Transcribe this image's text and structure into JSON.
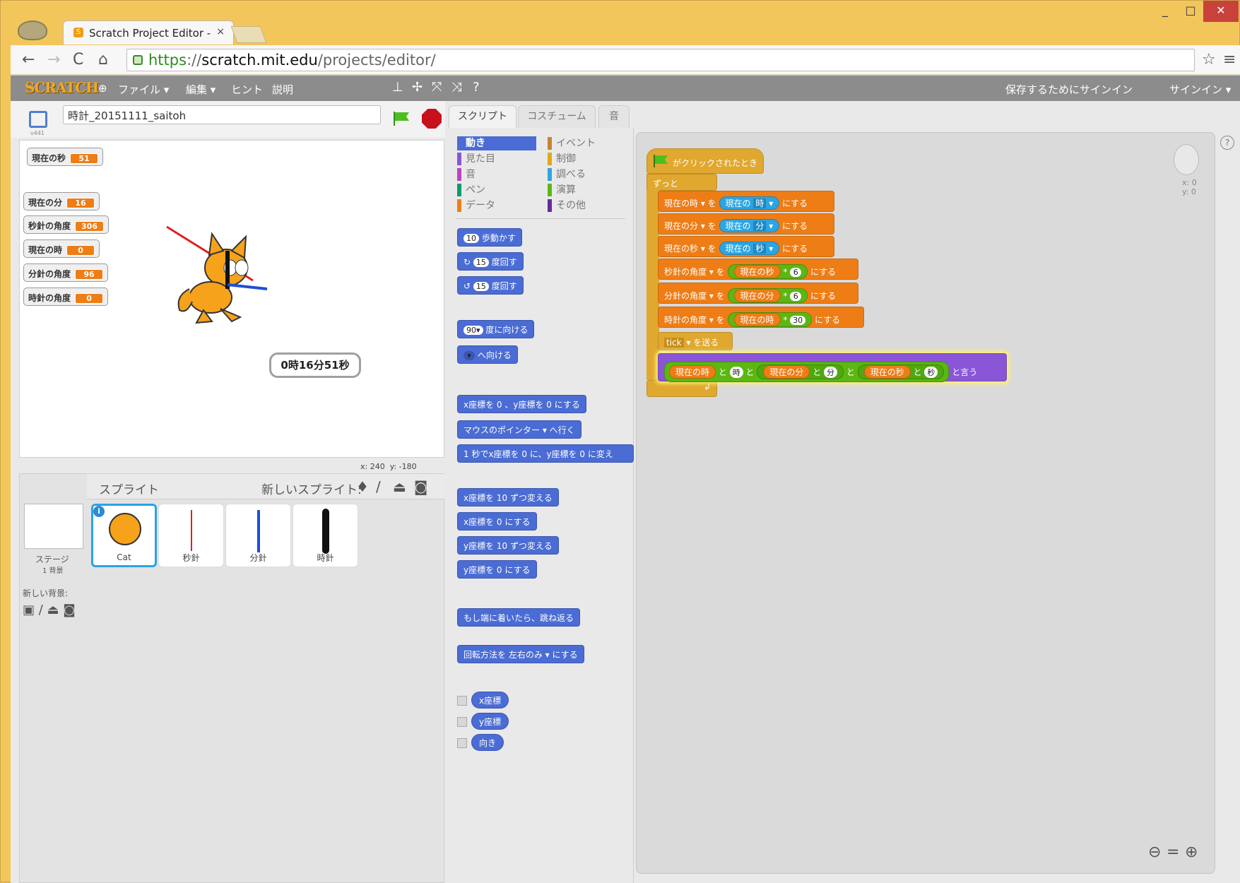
{
  "browser": {
    "tab_title": "Scratch Project Editor -",
    "tab_close": "×",
    "url_https": "https",
    "url_host": "scratch.mit.edu",
    "url_path": "/projects/editor/"
  },
  "menubar": {
    "logo": "SCRATCH",
    "file": "ファイル ▾",
    "edit": "編集 ▾",
    "tips": "ヒント",
    "about": "説明",
    "save_prompt": "保存するためにサインイン",
    "sign_in": "サインイン ▾"
  },
  "stage": {
    "project_title": "時計_20151111_saitoh",
    "version": "v441",
    "coords": "x: 240  y: -180",
    "speech": "0時16分51秒",
    "monitors": [
      {
        "label": "現在の秒",
        "value": "51"
      },
      {
        "label": "現在の分",
        "value": "16"
      },
      {
        "label": "秒針の角度",
        "value": "306"
      },
      {
        "label": "現在の時",
        "value": "0"
      },
      {
        "label": "分針の角度",
        "value": "96"
      },
      {
        "label": "時針の角度",
        "value": "0"
      }
    ]
  },
  "sprites": {
    "header": "スプライト",
    "new_sprite": "新しいスプライト:",
    "stage_label": "ステージ",
    "stage_sub": "1 背景",
    "new_backdrop": "新しい背景:",
    "items": [
      {
        "name": "Cat"
      },
      {
        "name": "秒針"
      },
      {
        "name": "分針"
      },
      {
        "name": "時針"
      }
    ]
  },
  "tabs": {
    "scripts": "スクリプト",
    "costumes": "コスチューム",
    "sounds": "音"
  },
  "categories": {
    "motion": "動き",
    "events": "イベント",
    "looks": "見た目",
    "control": "制御",
    "sound": "音",
    "sensing": "調べる",
    "pen": "ペン",
    "operators": "演算",
    "data": "データ",
    "more": "その他"
  },
  "palette": [
    {
      "text": "歩動かす",
      "num": "10"
    },
    {
      "text": "度回す",
      "num": "15"
    },
    {
      "text": "度回す",
      "num": "15"
    },
    {
      "text": "度に向ける",
      "num": "90▾"
    },
    {
      "text": "へ向ける"
    },
    {
      "text": "x座標を 0 、y座標を 0 にする"
    },
    {
      "text": "マウスのポインター ▾ へ行く"
    },
    {
      "text": "1 秒でx座標を 0 に、y座標を 0 に変え"
    },
    {
      "text": "x座標を 10 ずつ変える"
    },
    {
      "text": "x座標を 0 にする"
    },
    {
      "text": "y座標を 10 ずつ変える"
    },
    {
      "text": "y座標を 0 にする"
    },
    {
      "text": "もし端に着いたら、跳ね返る"
    },
    {
      "text": "回転方法を 左右のみ ▾ にする"
    },
    {
      "text": "x座標"
    },
    {
      "text": "y座標"
    },
    {
      "text": "向き"
    }
  ],
  "script": {
    "hat": "がクリックされたとき",
    "forever": "ずっと",
    "set1": {
      "var": "現在の時",
      "mid": "を",
      "rep": "現在の",
      "field": "時",
      "end": "にする"
    },
    "set2": {
      "var": "現在の分",
      "mid": "を",
      "rep": "現在の",
      "field": "分",
      "end": "にする"
    },
    "set3": {
      "var": "現在の秒",
      "mid": "を",
      "rep": "現在の",
      "field": "秒",
      "end": "にする"
    },
    "set4": {
      "var": "秒針の角度",
      "mid": "を",
      "rep": "現在の秒",
      "op": "*",
      "n": "6",
      "end": "にする"
    },
    "set5": {
      "var": "分針の角度",
      "mid": "を",
      "rep": "現在の分",
      "op": "*",
      "n": "6",
      "end": "にする"
    },
    "set6": {
      "var": "時針の角度",
      "mid": "を",
      "rep": "現在の時",
      "op": "*",
      "n": "30",
      "end": "にする"
    },
    "broadcast": {
      "msg": "tick",
      "end": "を送る"
    },
    "say": {
      "a": "現在の時",
      "b": "時",
      "c": "現在の分",
      "d": "分",
      "e": "現在の秒",
      "f": "秒",
      "and": "と",
      "end": "と言う"
    },
    "sprite_xy": "x: 0\ny: 0"
  }
}
